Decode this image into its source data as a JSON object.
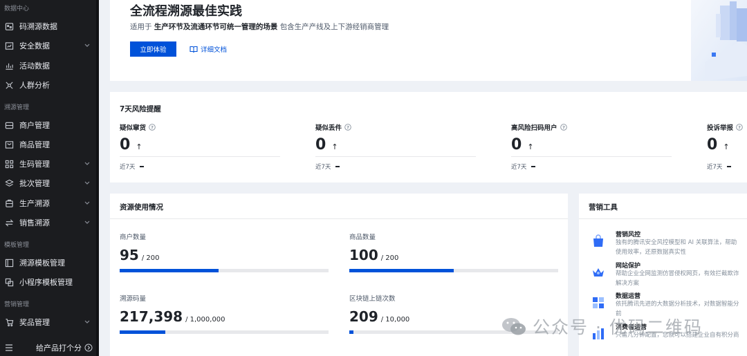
{
  "sidebar": {
    "sections": [
      {
        "title": "数据中心"
      },
      {
        "title": "溯源管理"
      },
      {
        "title": "模板管理"
      },
      {
        "title": "营销管理"
      }
    ],
    "items": [
      {
        "label": "码溯源数据",
        "icon": "qrcode-icon"
      },
      {
        "label": "安全数据",
        "icon": "shield-data-icon"
      },
      {
        "label": "活动数据",
        "icon": "activity-chart-icon"
      },
      {
        "label": "人群分析",
        "icon": "crowd-icon"
      },
      {
        "label": "商户管理",
        "icon": "store-icon"
      },
      {
        "label": "商品管理",
        "icon": "product-icon"
      },
      {
        "label": "生码管理",
        "icon": "grid-icon"
      },
      {
        "label": "批次管理",
        "icon": "layers-icon"
      },
      {
        "label": "生产溯源",
        "icon": "factory-icon"
      },
      {
        "label": "销售溯源",
        "icon": "exchange-icon"
      },
      {
        "label": "溯源模板管理",
        "icon": "template-icon"
      },
      {
        "label": "小程序模板管理",
        "icon": "miniprogram-icon"
      },
      {
        "label": "奖品管理",
        "icon": "cart-icon"
      }
    ],
    "feedback": "给产品打个分"
  },
  "hero": {
    "title": "全流程溯源最佳实践",
    "sub_prefix": "适用于",
    "sub_bold": "生产环节及流通环节可统一管理的场景",
    "sub_suffix": "包含生产产线及上下游经销商管理",
    "primary_button": "立即体验",
    "doc_link": "详细文档"
  },
  "risk": {
    "title": "7天风险提醒",
    "metrics": [
      {
        "name": "疑似窜货",
        "value": "0",
        "period": "近7天"
      },
      {
        "name": "疑似丢件",
        "value": "0",
        "period": "近7天"
      },
      {
        "name": "高风险扫码用户",
        "value": "0",
        "period": "近7天"
      },
      {
        "name": "投诉举报",
        "value": "0",
        "period": "近7天"
      }
    ]
  },
  "resources": {
    "title": "资源使用情况",
    "stats": [
      {
        "name": "商户数量",
        "used": "95",
        "total": "/ 200",
        "fraction": 0.475
      },
      {
        "name": "商品数量",
        "used": "100",
        "total": "/ 200",
        "fraction": 0.5
      },
      {
        "name": "溯源码量",
        "used": "217,398",
        "total": "/ 1,000,000",
        "fraction": 0.217
      },
      {
        "name": "区块链上链次数",
        "used": "209",
        "total": "/ 10,000",
        "fraction": 0.0209
      }
    ]
  },
  "marketing": {
    "title": "营销工具",
    "items": [
      {
        "title": "营销风控",
        "desc": "独有的腾讯安全风控模型和 AI 关联算法，帮助",
        "desc2": "使用效率，还原数据真实性"
      },
      {
        "title": "网站保护",
        "desc": "帮助企业全网监测仿冒侵权网页，有效拦截欺诈",
        "desc2": "解决方案"
      },
      {
        "title": "数据运营",
        "desc": "依托腾讯先进的大数据分析技术，对数据智能分",
        "desc2": "前"
      },
      {
        "title": "消费者运营",
        "desc": "只需几分钟配置，您就可以搭建企业自有积分商"
      }
    ]
  },
  "watermark": {
    "text": "公众号 · 优码二维码"
  },
  "colors": {
    "accent": "#0052d9",
    "sidebar_bg": "#1b1c1f"
  }
}
